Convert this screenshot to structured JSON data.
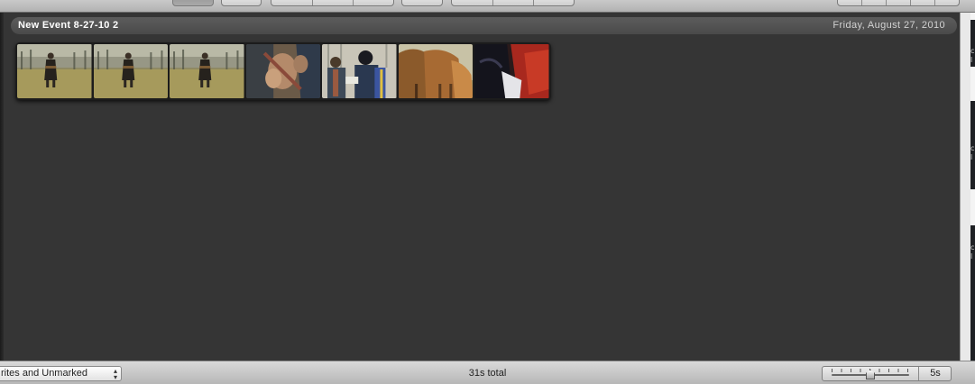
{
  "event": {
    "title": "New Event 8-27-10 2",
    "date": "Friday, August 27, 2010"
  },
  "filmstrip": {
    "frames": [
      {
        "icon": "field-person-thumbnail"
      },
      {
        "icon": "field-person-thumbnail"
      },
      {
        "icon": "field-person-thumbnail"
      },
      {
        "icon": "hands-closeup-thumbnail"
      },
      {
        "icon": "men-group-thumbnail"
      },
      {
        "icon": "horses-thumbnail"
      },
      {
        "icon": "dark-red-closeup-thumbnail"
      }
    ]
  },
  "bottom_bar": {
    "filter_value": "rites and Unmarked",
    "total": "31s total",
    "zoom_value": "5s",
    "zoom_level": 0.5
  },
  "colors": {
    "background": "#353535",
    "header_pill": "#535353",
    "bottom_bar": "#c9c9c9"
  }
}
